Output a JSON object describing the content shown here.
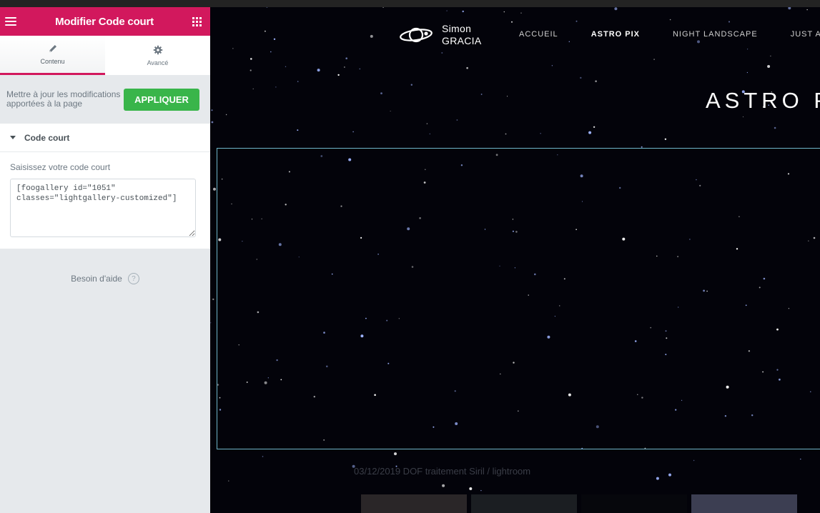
{
  "panel": {
    "title": "Modifier Code court",
    "tabs": [
      {
        "label": "Contenu",
        "icon": "pencil-icon",
        "active": true
      },
      {
        "label": "Avancé",
        "icon": "gear-icon",
        "active": false
      }
    ],
    "apply_text": "Mettre à jour les modifications apportées à la page",
    "apply_button": "APPLIQUER",
    "section_title": "Code court",
    "field_label": "Saisissez votre code court",
    "shortcode_value": "[foogallery id=\"1051\"\nclasses=\"lightgallery-customized\"]",
    "help_text": "Besoin d'aide",
    "accent_color": "#d2185d",
    "apply_color": "#39b54a"
  },
  "site": {
    "logo_line1": "Simon",
    "logo_line2": "GRACIA",
    "nav": [
      "ACCUEIL",
      "ASTRO PIX",
      "NIGHT LANDSCAPE",
      "JUST A"
    ],
    "active_nav": "ASTRO PIX",
    "page_title": "ASTRO P",
    "caption": "03/12/2019 DOF traitement Siril / lightroom"
  }
}
